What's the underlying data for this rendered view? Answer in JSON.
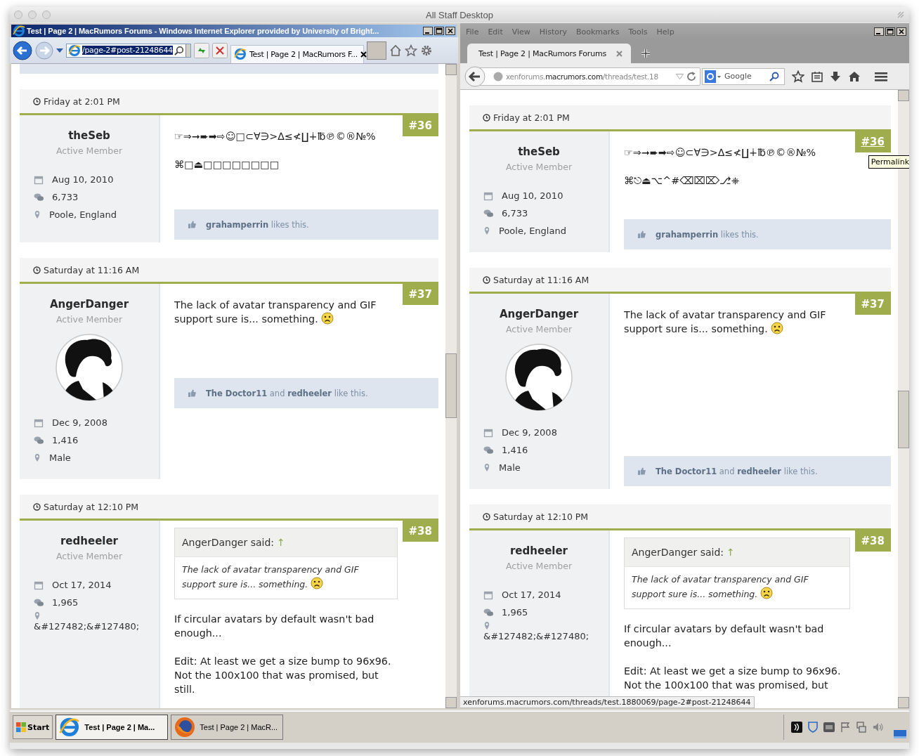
{
  "desktop": {
    "title": "All Staff Desktop"
  },
  "ie": {
    "title": "Test | Page 2 | MacRumors Forums - Windows Internet Explorer provided by University of Bright...",
    "address": "/page-2#post-21248644",
    "tab": "Test | Page 2 | MacRumors F...",
    "posts": [
      {
        "date": "Friday at 2:01 PM",
        "number": "#36",
        "hover": false,
        "author": "theSeb",
        "role": "Active Member",
        "avatar": false,
        "joined": "Aug 10, 2010",
        "messages": "6,733",
        "location": "Poole, England",
        "paragraphs": [
          {
            "text": "☞⇒➞➨➡⇨☺□⊂∀∋>∆≤≮∐∔℔℗©®№%",
            "emoji": false
          },
          {
            "text": "⌘□⏏□□□□□□□□",
            "emoji": false
          }
        ],
        "likes": "**grahamperrin** likes this."
      },
      {
        "date": "Saturday at 11:16 AM",
        "number": "#37",
        "hover": false,
        "author": "AngerDanger",
        "role": "Active Member",
        "avatar": true,
        "joined": "Dec 9, 2008",
        "messages": "1,416",
        "location": "Male",
        "paragraphs": [
          {
            "text": "The lack of avatar transparency and GIF support sure is... something.",
            "emoji": true
          }
        ],
        "likes": "**The Doctor11** and **redheeler** like this."
      },
      {
        "date": "Saturday at 12:10 PM",
        "number": "#38",
        "hover": false,
        "author": "redheeler",
        "role": "Active Member",
        "avatar": false,
        "joined": "Oct 17, 2014",
        "messages": "1,965",
        "location": "&#127482;&#127480;",
        "quote": {
          "author": "AngerDanger said:",
          "jump": "↑",
          "text": "The lack of avatar transparency and GIF support sure is... something.",
          "emoji": true
        },
        "paragraphs": [
          {
            "text": "If circular avatars by default wasn't bad enough...",
            "emoji": false
          },
          {
            "text": "Edit: At least we get a size bump to 96x96. Not the 100x100 that was promised, but still.",
            "emoji": false
          }
        ]
      }
    ]
  },
  "firefox": {
    "menu": [
      "File",
      "Edit",
      "View",
      "History",
      "Bookmarks",
      "Tools",
      "Help"
    ],
    "tab": "Test | Page 2 | MacRumors Forums",
    "address": {
      "prefix": "xenforums.",
      "domain": "macrumors.com",
      "path": "/threads/test.18"
    },
    "search": {
      "placeholder": "Google"
    },
    "tooltip": "Permalink",
    "status": "xenforums.macrumors.com/threads/test.1880069/page-2#post-21248644",
    "posts": [
      {
        "date": "Friday at 2:01 PM",
        "number": "#36",
        "hover": true,
        "author": "theSeb",
        "role": "Active Member",
        "avatar": false,
        "joined": "Aug 10, 2010",
        "messages": "6,733",
        "location": "Poole, England",
        "paragraphs": [
          {
            "text": "☞⇒➞➨➡⇨☺⊂∀∋>∆≤≮∐∔℔℗©®№%",
            "emoji": false
          },
          {
            "text": "⌘⎋⏏⌥^#⌫⌧⌦⎇⎈",
            "emoji": false
          }
        ],
        "likes": "**grahamperrin** likes this."
      },
      {
        "date": "Saturday at 11:16 AM",
        "number": "#37",
        "hover": false,
        "author": "AngerDanger",
        "role": "Active Member",
        "avatar": true,
        "joined": "Dec 9, 2008",
        "messages": "1,416",
        "location": "Male",
        "paragraphs": [
          {
            "text": "The lack of avatar transparency and GIF support sure is... something.",
            "emoji": true
          }
        ],
        "likes": "**The Doctor11** and **redheeler** like this."
      },
      {
        "date": "Saturday at 12:10 PM",
        "number": "#38",
        "hover": false,
        "author": "redheeler",
        "role": "Active Member",
        "avatar": false,
        "joined": "Oct 17, 2014",
        "messages": "1,965",
        "location": "&#127482;&#127480;",
        "quote": {
          "author": "AngerDanger said:",
          "jump": "↑",
          "text": "The lack of avatar transparency and GIF support sure is... something.",
          "emoji": true
        },
        "paragraphs": [
          {
            "text": "If circular avatars by default wasn't bad enough...",
            "emoji": false
          },
          {
            "text": "Edit: At least we get a size bump to 96x96. Not the 100x100 that was promised, but",
            "emoji": false
          }
        ]
      }
    ]
  },
  "taskbar": {
    "start": "Start",
    "items": [
      {
        "label": "Test | Page 2 | Ma...",
        "selected": true,
        "kind": "ie"
      },
      {
        "label": "Test | Page 2 | MacR...",
        "selected": false,
        "kind": "firefox"
      }
    ]
  }
}
